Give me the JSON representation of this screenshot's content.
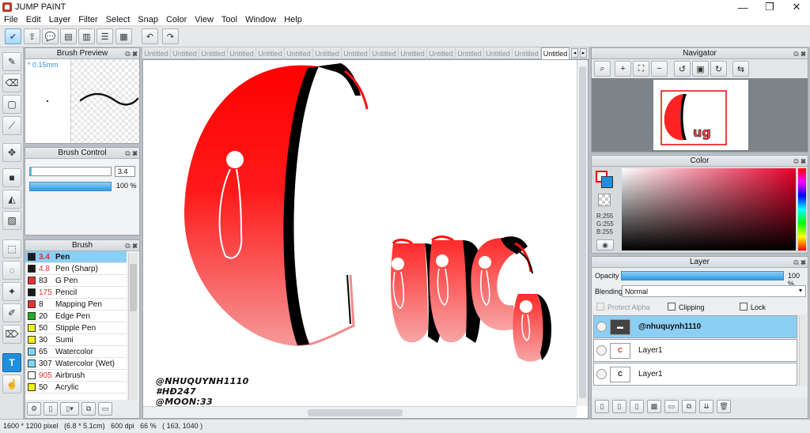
{
  "window": {
    "title": "JUMP PAINT",
    "minimize": "—",
    "maximize": "❐",
    "close": "✕"
  },
  "menu": [
    "File",
    "Edit",
    "Layer",
    "Filter",
    "Select",
    "Snap",
    "Color",
    "View",
    "Tool",
    "Window",
    "Help"
  ],
  "panels": {
    "brush_preview": {
      "title": "Brush Preview",
      "size": "* 0.15mm"
    },
    "brush_control": {
      "title": "Brush Control",
      "size_value": "3.4",
      "opacity_value": "100 %",
      "opacity": 100
    },
    "brush": {
      "title": "Brush",
      "items": [
        {
          "num": "3.4",
          "name": "Pen",
          "color": "#1a1a1a",
          "num_red": true,
          "selected": true
        },
        {
          "num": "4.8",
          "name": "Pen (Sharp)",
          "color": "#1a1a1a",
          "num_red": true
        },
        {
          "num": "83",
          "name": "G Pen",
          "color": "#e53232"
        },
        {
          "num": "175",
          "name": "Pencil",
          "color": "#1a1a1a",
          "num_red": true
        },
        {
          "num": "8",
          "name": "Mapping Pen",
          "color": "#e53232"
        },
        {
          "num": "20",
          "name": "Edge Pen",
          "color": "#22aa22"
        },
        {
          "num": "50",
          "name": "Stipple Pen",
          "color": "#eeee22"
        },
        {
          "num": "30",
          "name": "Sumi",
          "color": "#eeee22"
        },
        {
          "num": "65",
          "name": "Watercolor",
          "color": "#7fd8ff"
        },
        {
          "num": "307",
          "name": "Watercolor (Wet)",
          "color": "#7fd8ff"
        },
        {
          "num": "905",
          "name": "Airbrush",
          "color": "#ffffff",
          "num_red": true
        },
        {
          "num": "50",
          "name": "Acrylic",
          "color": "#eeee22"
        }
      ]
    },
    "navigator": {
      "title": "Navigator"
    },
    "color": {
      "title": "Color",
      "r": "R:255",
      "g": "G:255",
      "b": "B:255"
    },
    "layer": {
      "title": "Layer",
      "opacity_label": "Opacity",
      "opacity_value": "100 %",
      "opacity": 100,
      "blending_label": "Blending",
      "blending_value": "Normal",
      "protect_alpha": "Protect Alpha",
      "clipping": "Clipping",
      "lock": "Lock",
      "rows": [
        {
          "name": "@nhuquynh1110",
          "selected": true
        },
        {
          "name": "Layer1"
        },
        {
          "name": "Layer1"
        }
      ]
    }
  },
  "tabs": [
    "Untitled",
    "Untitled",
    "Untitled",
    "Untitled",
    "Untitled",
    "Untitled",
    "Untitled",
    "Untitled",
    "Untitled",
    "Untitled",
    "Untitled",
    "Untitled",
    "Untitled",
    "Untitled",
    "Untitled"
  ],
  "canvas": {
    "signature": [
      "@NHUQUYNH1110",
      "#HĐ247",
      "@MOON:33"
    ],
    "colors": {
      "red": "#ff0d0d",
      "pink": "#f28a8a",
      "black": "#000000"
    }
  },
  "status": "1600 * 1200 pixel   (6.8 * 5.1cm)   600 dpi   66 %   ( 163, 1040 )"
}
